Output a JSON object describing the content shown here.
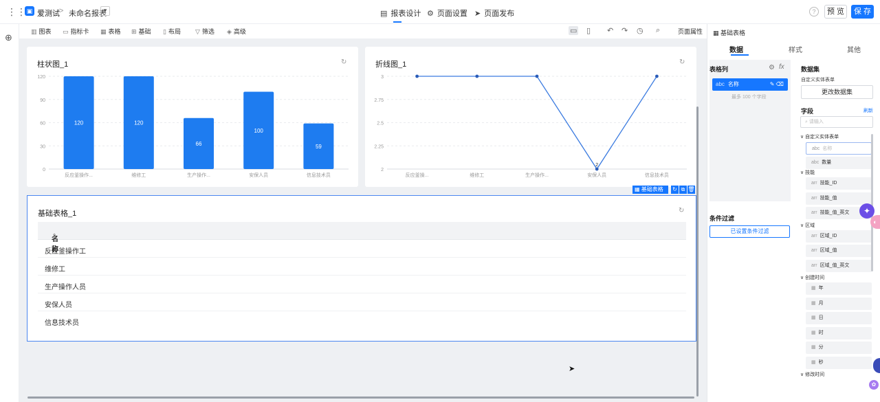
{
  "topbar": {
    "app_name": "爱测试",
    "crumb_sep": ">",
    "report_name": "未命名报表",
    "tabs": [
      {
        "label": "报表设计",
        "icon": "document-icon"
      },
      {
        "label": "页面设置",
        "icon": "settings-icon"
      },
      {
        "label": "页面发布",
        "icon": "send-icon"
      }
    ],
    "preview_label": "预 览",
    "save_label": "保 存"
  },
  "toolbar": {
    "items": [
      "图表",
      "指标卡",
      "表格",
      "基础",
      "布局",
      "筛选",
      "高级"
    ],
    "page_props": "页面属性"
  },
  "bar_chart": {
    "title": "柱状图_1",
    "chart_data": {
      "type": "bar",
      "categories": [
        "反应釜操作...",
        "维修工",
        "生产操作...",
        "安保人员",
        "信息技术员"
      ],
      "values": [
        120,
        120,
        66,
        100,
        59
      ],
      "ylim": [
        0,
        120
      ],
      "yticks": [
        0,
        30,
        60,
        90,
        120
      ],
      "grid": true,
      "color": "#1e7cf0"
    }
  },
  "line_chart": {
    "title": "折线图_1",
    "chart_data": {
      "type": "line",
      "categories": [
        "反应釜操...",
        "维修工",
        "生产操作...",
        "安保人员",
        "信息技术员"
      ],
      "values": [
        3,
        3,
        3,
        2,
        3
      ],
      "ylim": [
        2,
        3
      ],
      "yticks": [
        "2",
        "2.25",
        "2.5",
        "2.75",
        "3"
      ],
      "data_label": "2",
      "grid": true,
      "color": "#3b7be0"
    }
  },
  "table": {
    "title": "基础表格_1",
    "header": "名称",
    "rows": [
      "反应釜操作工",
      "维修工",
      "生产操作人员",
      "安保人员",
      "信息技术员"
    ],
    "selection_label": "基础表格"
  },
  "right_panel": {
    "title": "基础表格",
    "tabs": [
      "数据",
      "样式",
      "其他"
    ],
    "columns_title": "表格列",
    "column_chip": {
      "type": "abc",
      "label": "名称"
    },
    "column_hint": "最多 100 个字段",
    "filter_title": "条件过滤",
    "filter_button": "已设置条件过滤",
    "dataset_title": "数据集",
    "dataset_name": "自定义实体表单",
    "change_dataset": "更改数据集",
    "fields_title": "字段",
    "refresh": "刷新",
    "search_placeholder": "请输入",
    "tree": {
      "root": "自定义实体表单",
      "root_fields": [
        {
          "type": "abc",
          "label": "名称"
        },
        {
          "type": "abc",
          "label": "数量"
        }
      ],
      "groups": [
        {
          "label": "技能",
          "fields": [
            {
              "type": "arr",
              "label": "技能_ID"
            },
            {
              "type": "arr",
              "label": "技能_值"
            },
            {
              "type": "arr",
              "label": "技能_值_英文"
            }
          ]
        },
        {
          "label": "区域",
          "fields": [
            {
              "type": "arr",
              "label": "区域_ID"
            },
            {
              "type": "arr",
              "label": "区域_值"
            },
            {
              "type": "arr",
              "label": "区域_值_英文"
            }
          ]
        },
        {
          "label": "创建时间",
          "fields": [
            {
              "type": "cal",
              "label": "年"
            },
            {
              "type": "cal",
              "label": "月"
            },
            {
              "type": "cal",
              "label": "日"
            },
            {
              "type": "cal",
              "label": "时"
            },
            {
              "type": "cal",
              "label": "分"
            },
            {
              "type": "cal",
              "label": "秒"
            }
          ]
        }
      ],
      "last": "修改时间"
    }
  }
}
